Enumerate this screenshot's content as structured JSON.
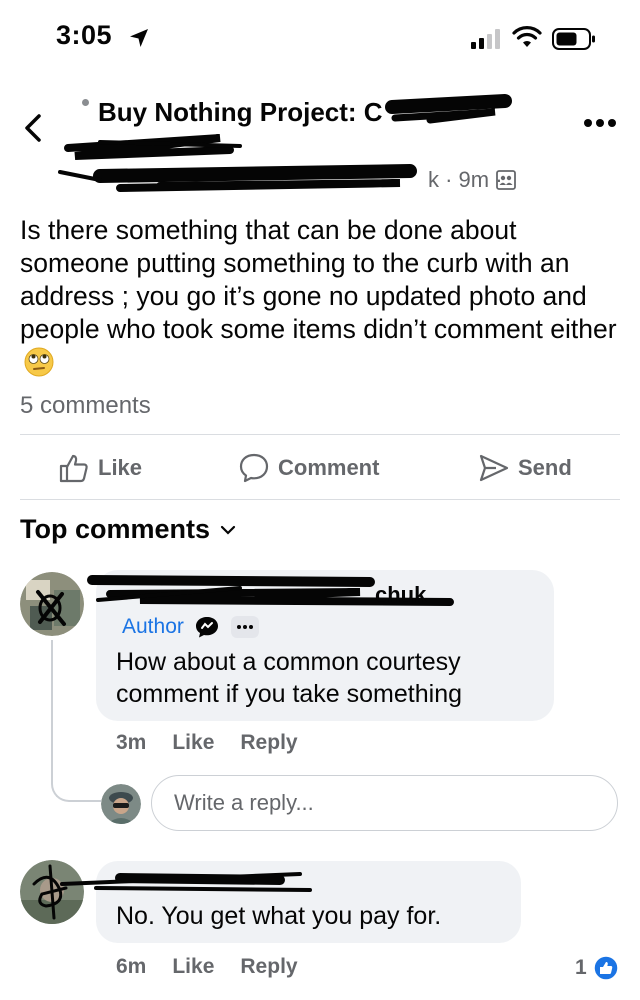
{
  "status_bar": {
    "time": "3:05"
  },
  "header": {
    "group_title": "Buy Nothing Project: C",
    "meta_suffix": "k · 9m ·"
  },
  "post": {
    "text": "Is there something  that can be done about someone putting something to the curb with an address ; you go it’s gone no updated photo and people who took some items didn’t  comment either",
    "comments_count": "5 comments"
  },
  "actions": {
    "like": "Like",
    "comment": "Comment",
    "send": "Send"
  },
  "comments_section": {
    "heading": "Top comments",
    "comments": [
      {
        "name_visible": "chuk",
        "badge": "Author",
        "text": "How about a common courtesy comment if you take something",
        "time": "3m",
        "like": "Like",
        "reply": "Reply"
      },
      {
        "text": "No. You get what you pay for.",
        "time": "6m",
        "like": "Like",
        "reply": "Reply",
        "reaction_count": "1"
      }
    ],
    "reply_placeholder": "Write a reply..."
  },
  "icons": {
    "location": "location-arrow-icon",
    "signal": "signal-icon",
    "wifi": "wifi-icon",
    "battery": "battery-icon",
    "back": "chevron-left-icon",
    "more": "more-dots-icon",
    "group": "group-icon",
    "like": "thumbs-up-icon",
    "comment": "comment-bubble-icon",
    "send": "send-icon",
    "eyeroll_emoji": "eye-roll-emoji-icon"
  },
  "colors": {
    "accent": "#1b74e4",
    "secondary_text": "#65676b",
    "bubble": "#f0f2f5"
  }
}
